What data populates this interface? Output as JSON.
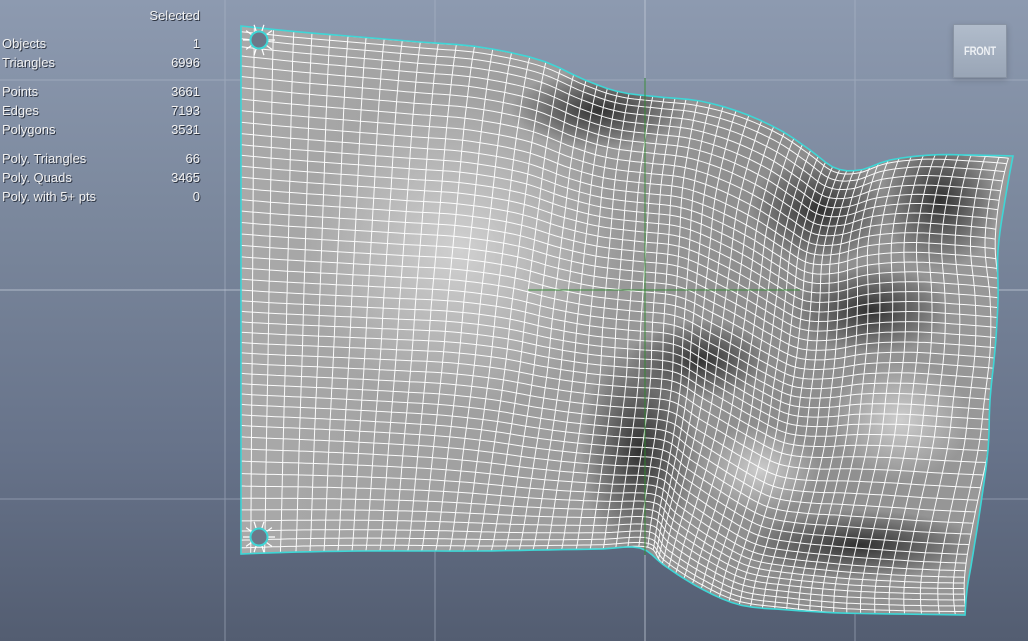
{
  "viewport": {
    "name": "front"
  },
  "hud": {
    "header": "Selected",
    "group1": [
      {
        "label": "Objects",
        "value": "1"
      },
      {
        "label": "Triangles",
        "value": "6996"
      }
    ],
    "group2": [
      {
        "label": "Points",
        "value": "3661"
      },
      {
        "label": "Edges",
        "value": "7193"
      },
      {
        "label": "Polygons",
        "value": "3531"
      }
    ],
    "group3": [
      {
        "label": "Poly.  Triangles",
        "value": "66"
      },
      {
        "label": "Poly.  Quads",
        "value": "3465"
      },
      {
        "label": "Poly.  with  5+  pts",
        "value": "0"
      }
    ]
  },
  "view_cube": {
    "label": "FRONT"
  },
  "colors": {
    "outline": "#3ed6d6",
    "wire": "#ffffff",
    "grid": "#b0bacb",
    "axis": "#2f8a2f",
    "pin": "#3ed6d6"
  }
}
